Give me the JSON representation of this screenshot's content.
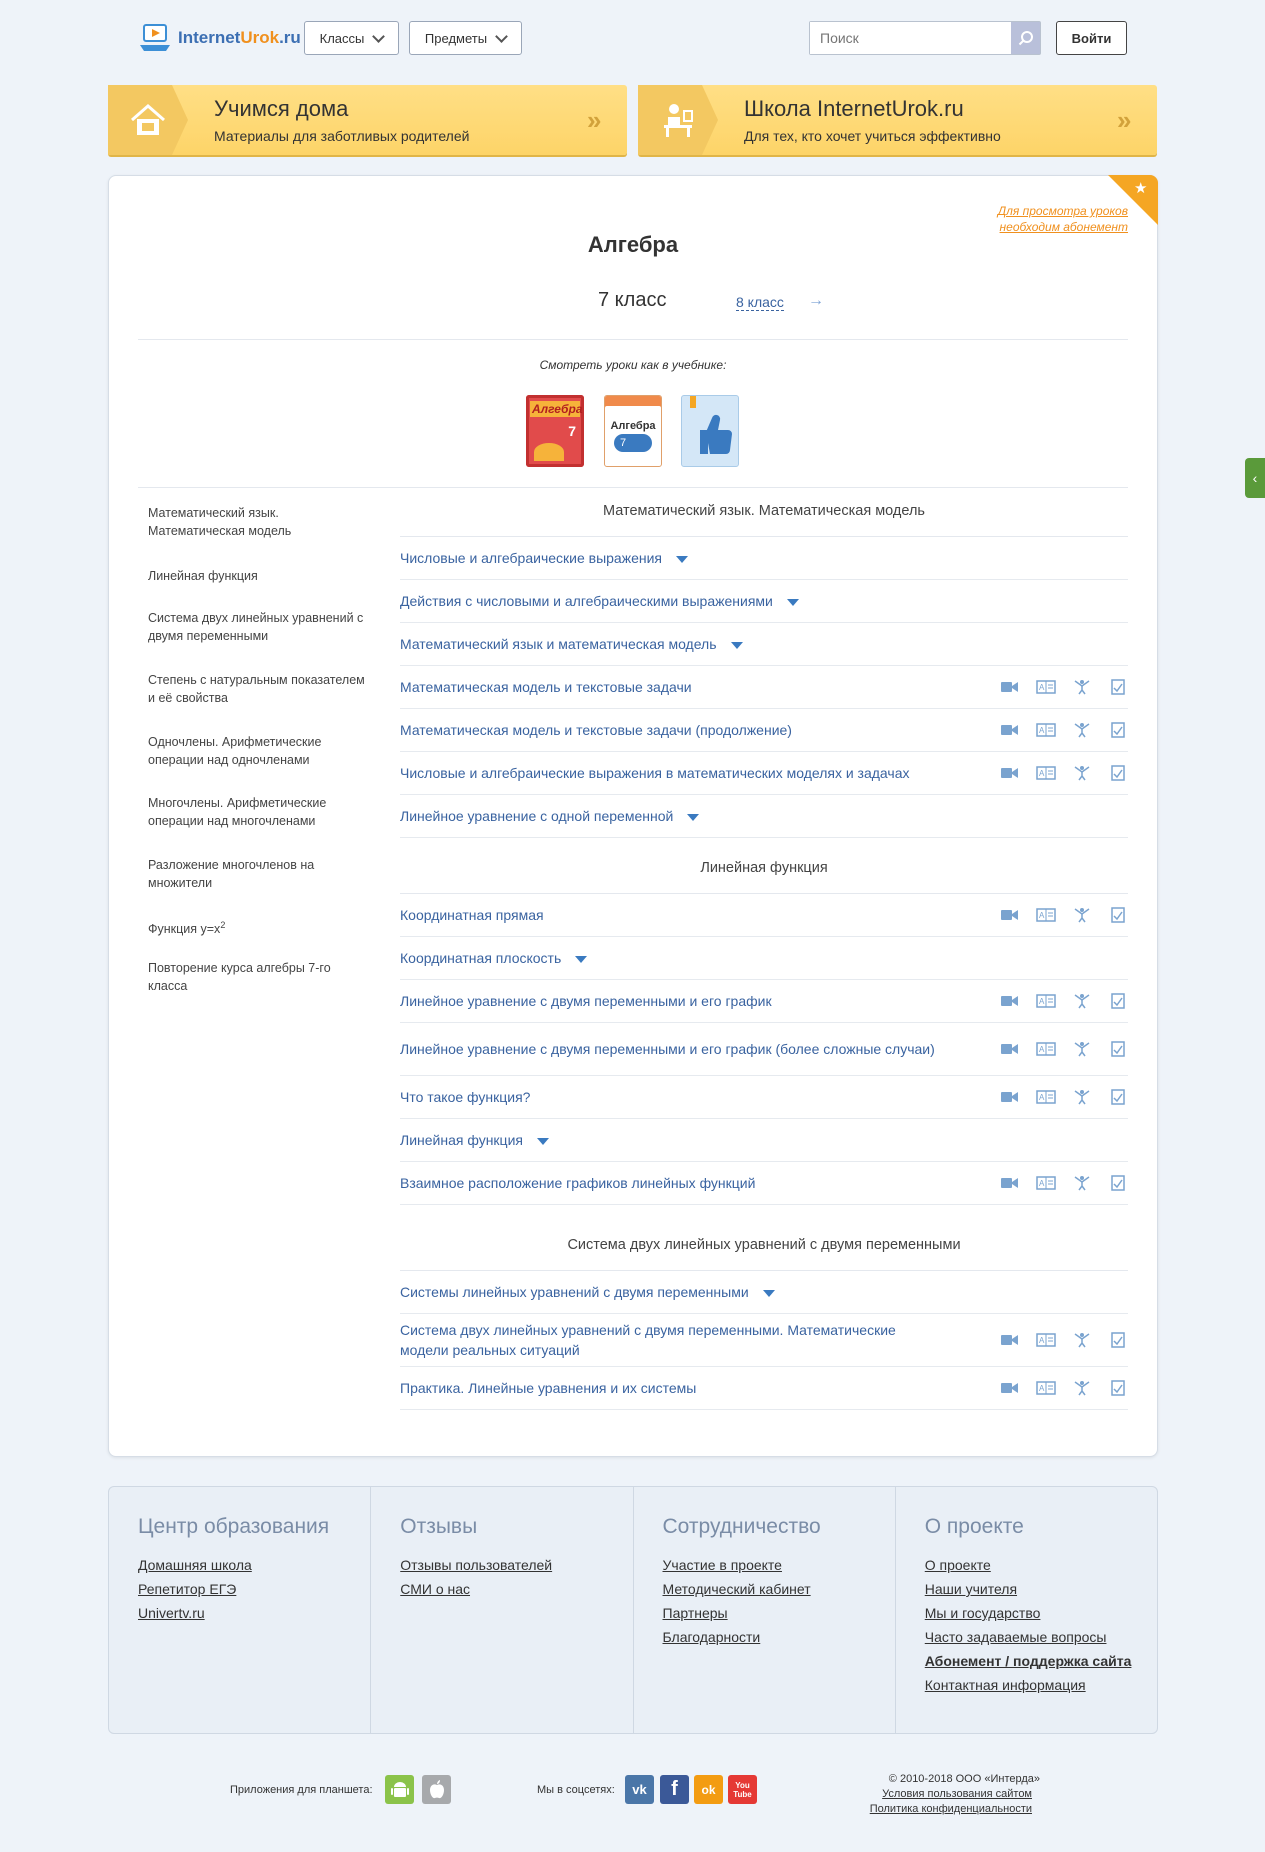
{
  "header": {
    "logo_text_a": "Internet",
    "logo_text_b": "Urok",
    "logo_text_c": ".ru",
    "classes_label": "Классы",
    "subjects_label": "Предметы",
    "search_placeholder": "Поиск",
    "login_label": "Войти"
  },
  "banners": [
    {
      "title": "Учимся дома",
      "subtitle": "Материалы для заботливых родителей"
    },
    {
      "title": "Школа InternetUrok.ru",
      "subtitle": "Для тех, кто хочет учиться эффективно"
    }
  ],
  "main": {
    "subscription_note": "Для просмотра уроков необходим абонемент",
    "title": "Алгебра",
    "grade": "7 класс",
    "next_grade": "8 класс",
    "books_label": "Смотреть уроки как в учебнике:",
    "book1_title": "Алгебра",
    "book1_num": "7",
    "book2_title": "Алгебра",
    "book2_num": "7"
  },
  "sidebar": [
    "Математический язык. Математическая модель",
    "Линейная функция",
    "Система двух линейных уравнений с двумя переменными",
    "Степень с натуральным показателем и её свойства",
    "Одночлены. Арифметические операции над одночленами",
    "Многочлены. Арифметические операции над многочленами",
    "Разложение многочленов на множители",
    "Функция y=x",
    "Повторение курса алгебры 7-го класса"
  ],
  "sidebar_sup": "2",
  "sections": [
    {
      "title": "Математический язык. Математическая модель",
      "lessons": [
        {
          "title": "Числовые и алгебраические выражения",
          "expandable": true
        },
        {
          "title": "Действия с числовыми и алгебраическими выражениями",
          "expandable": true
        },
        {
          "title": "Математический язык и математическая модель",
          "expandable": true
        },
        {
          "title": "Математическая модель и текстовые задачи",
          "expandable": false
        },
        {
          "title": "Математическая модель и текстовые задачи (продолжение)",
          "expandable": false
        },
        {
          "title": "Числовые и алгебраические выражения в математических моделях и задачах",
          "expandable": false
        },
        {
          "title": "Линейное уравнение с одной переменной",
          "expandable": true
        }
      ]
    },
    {
      "title": "Линейная функция",
      "lessons": [
        {
          "title": "Координатная прямая",
          "expandable": false
        },
        {
          "title": "Координатная плоскость",
          "expandable": true
        },
        {
          "title": "Линейное уравнение с двумя переменными и его график",
          "expandable": false
        },
        {
          "title": "Линейное уравнение с двумя переменными и его график (более сложные случаи)",
          "expandable": false
        },
        {
          "title": "Что такое функция?",
          "expandable": false
        },
        {
          "title": "Линейная функция",
          "expandable": true
        },
        {
          "title": "Взаимное расположение графиков линейных функций",
          "expandable": false
        }
      ]
    },
    {
      "title": "Система двух линейных уравнений с двумя переменными",
      "lessons": [
        {
          "title": "Системы линейных уравнений с двумя переменными",
          "expandable": true
        },
        {
          "title": "Система двух линейных уравнений с двумя переменными. Математические модели реальных ситуаций",
          "expandable": false
        },
        {
          "title": "Практика. Линейные уравнения и их системы",
          "expandable": false
        }
      ]
    }
  ],
  "footer": {
    "columns": [
      {
        "title": "Центр образования",
        "links": [
          "Домашняя школа",
          "Репетитор ЕГЭ",
          "Univertv.ru"
        ]
      },
      {
        "title": "Отзывы",
        "links": [
          "Отзывы пользователей",
          "СМИ о нас"
        ]
      },
      {
        "title": "Сотрудничество",
        "links": [
          "Участие в проекте",
          "Методический кабинет",
          "Партнеры",
          "Благодарности"
        ]
      },
      {
        "title": "О проекте",
        "links": [
          "О проекте",
          "Наши учителя",
          "Мы и государство",
          "Часто задаваемые вопросы",
          "Абонемент / поддержка сайта",
          "Контактная информация"
        ]
      }
    ],
    "apps_label": "Приложения для планшета:",
    "social_label": "Мы в соцсетях:",
    "copyright": "© 2010-2018 ООО «Интерда»",
    "terms_link": "Условия пользования сайтом",
    "privacy_link": "Политика конфиденциальности",
    "social": [
      "vk",
      "f",
      "ok",
      "You Tube"
    ]
  },
  "colors": {
    "accent": "#3a63a0",
    "banner": "#fdd468",
    "corner": "#f5a623",
    "android": "#8bc34a",
    "apple": "#a7a9ac",
    "vk": "#4a76a8",
    "fb": "#3b5998",
    "ok": "#f39c12",
    "yt": "#e53935"
  }
}
